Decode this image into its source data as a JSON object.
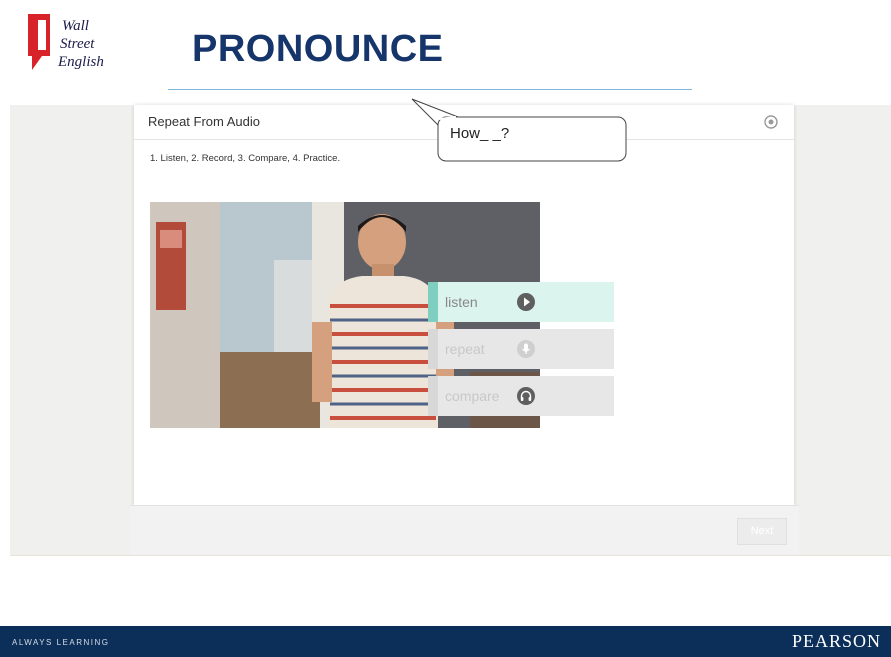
{
  "brand": {
    "logo_text": [
      "Wall",
      "Street",
      "English"
    ]
  },
  "header": {
    "title": "PRONOUNCE"
  },
  "activity": {
    "title": "Repeat From Audio",
    "instructions": "1. Listen,  2. Record,  3. Compare,  4. Practice.",
    "bubble_text": "How_ _?",
    "controls": [
      {
        "label": "listen",
        "icon": "play-icon",
        "active": true
      },
      {
        "label": "repeat",
        "icon": "microphone-icon",
        "active": false
      },
      {
        "label": "compare",
        "icon": "headphones-icon",
        "active": false
      }
    ],
    "next_label": "Next"
  },
  "footer": {
    "tagline": "ALWAYS LEARNING",
    "brand": "PEARSON"
  },
  "colors": {
    "title_blue": "#16356b",
    "active_green": "#7fcfc0",
    "footer_navy": "#0c2f5a",
    "logo_red": "#d8232a"
  }
}
